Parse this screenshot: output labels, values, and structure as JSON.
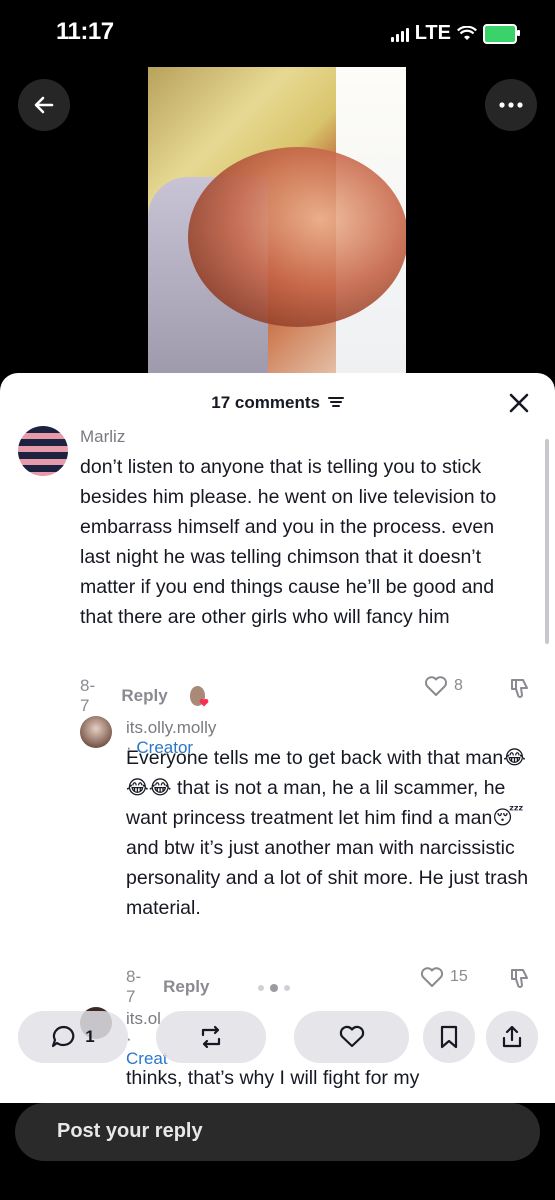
{
  "status_bar": {
    "time": "11:17",
    "network": "LTE",
    "battery_color": "#3ad36b"
  },
  "sheet": {
    "comments_count_label": "17 comments",
    "comments": [
      {
        "username": "Marliz",
        "text": "don’t listen to anyone that is telling you to stick besides him please. he went on live television to embarrass himself and you in the process. even last night he was telling chimson that it doesn’t matter if you end things cause he’ll be good and that there are other girls who will fancy him",
        "date": "8-7",
        "reply_label": "Reply",
        "likes": "8"
      },
      {
        "username": "its.olly.molly",
        "separator": " · ",
        "badge": "Creator",
        "text": "Everyone tells me to get back with that man😂😂😂 that is not a man, he a lil scammer, he want princess treatment let him find a man😴 and btw it’s just another man with narcissistic personality and a lot of shit more. He just trash material.",
        "date": "8-7",
        "reply_label": "Reply",
        "likes": "15"
      },
      {
        "username_partial": "its.ol",
        "badge_partial": "Creat",
        "text_partial": "thinks, that’s why I will fight for my"
      }
    ]
  },
  "action_bar": {
    "comment_count": "1"
  },
  "bottom": {
    "reply_placeholder": "Post your reply"
  },
  "icons": {
    "back": "arrow-left-icon",
    "more": "more-horizontal-icon",
    "close": "close-icon",
    "sort": "sort-lines-icon",
    "heart": "heart-icon",
    "dislike": "thumbs-down-icon",
    "comment": "comment-bubble-icon",
    "repost": "repost-icon",
    "bookmark": "bookmark-icon",
    "share": "share-icon"
  }
}
